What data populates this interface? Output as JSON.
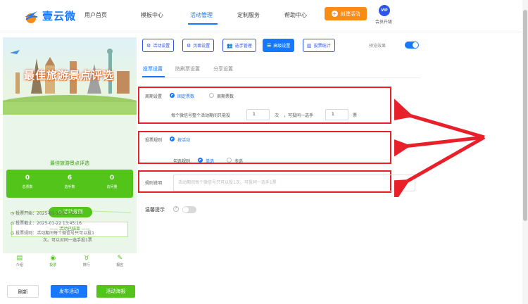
{
  "brand": {
    "name": "壹云微"
  },
  "nav": {
    "items": [
      "用户首页",
      "模板中心",
      "活动管理",
      "定制服务",
      "帮助中心"
    ],
    "active_index": 2,
    "create_label": "创建活动",
    "vip_badge": "VIP",
    "vip_label": "会员升级"
  },
  "preview": {
    "banner_title": "最佳旅游景点评选",
    "title": "最佳旅游景点评选",
    "stats": [
      {
        "value": "0",
        "label": "总票数"
      },
      {
        "value": "6",
        "label": "选手数"
      },
      {
        "value": "0",
        "label": "访问量"
      }
    ],
    "rules_title": "活动规则",
    "ended_text": "活动已结束",
    "info": [
      "投票开始：2025-01-16 13:45:16",
      "投票截止：2025-01-22 13:45:16",
      "投票规则：活动期间每个微信号只可以投1",
      "次。可以对同一选手投1票"
    ],
    "bottom_nav": [
      {
        "label": "介绍",
        "icon": "intro-icon"
      },
      {
        "label": "投票",
        "icon": "vote-icon"
      },
      {
        "label": "排行",
        "icon": "rank-icon"
      },
      {
        "label": "报名",
        "icon": "signup-icon"
      }
    ],
    "bottom_nav_active": 1
  },
  "actions": {
    "refresh": "刷新",
    "publish": "发布活动",
    "poster": "活动海报"
  },
  "toolbar": {
    "buttons": [
      {
        "label": "活动设置",
        "icon": "gear-icon"
      },
      {
        "label": "页面设置",
        "icon": "page-gear-icon"
      },
      {
        "label": "选手管理",
        "icon": "users-icon"
      },
      {
        "label": "高级设置",
        "icon": "advanced-icon"
      },
      {
        "label": "投票统计",
        "icon": "chart-icon"
      }
    ],
    "active_index": 3,
    "preview_effect_label": "预览效果",
    "preview_effect_on": true
  },
  "subtabs": {
    "items": [
      "投票设置",
      "防刷票设置",
      "分享设置"
    ],
    "active_index": 0
  },
  "settings": {
    "cycle": {
      "label": "周期设置",
      "options": [
        "固定票数",
        "周期票数"
      ],
      "selected": 0,
      "desc_prefix": "每个微信号整个活动期间只能投",
      "count_value": "1",
      "unit_times": "次",
      "desc_mid": "，可投同一选手",
      "same_value": "1",
      "unit_votes": "票"
    },
    "rule": {
      "label": "投票规则",
      "option": "按活动",
      "check_label": "勾选规则",
      "check_options": [
        "单选",
        "多选"
      ],
      "check_selected": 0
    },
    "rule_desc": {
      "label": "规则说明",
      "placeholder": "活动期间每个微信号只可以投1次。可投同一选手1票"
    },
    "tip": {
      "label": "温馨提示",
      "help": "?",
      "enabled": false
    }
  },
  "colors": {
    "primary": "#1677ff",
    "green": "#52c41a",
    "orange": "#fa8c16",
    "highlight_red": "#e8202a"
  }
}
